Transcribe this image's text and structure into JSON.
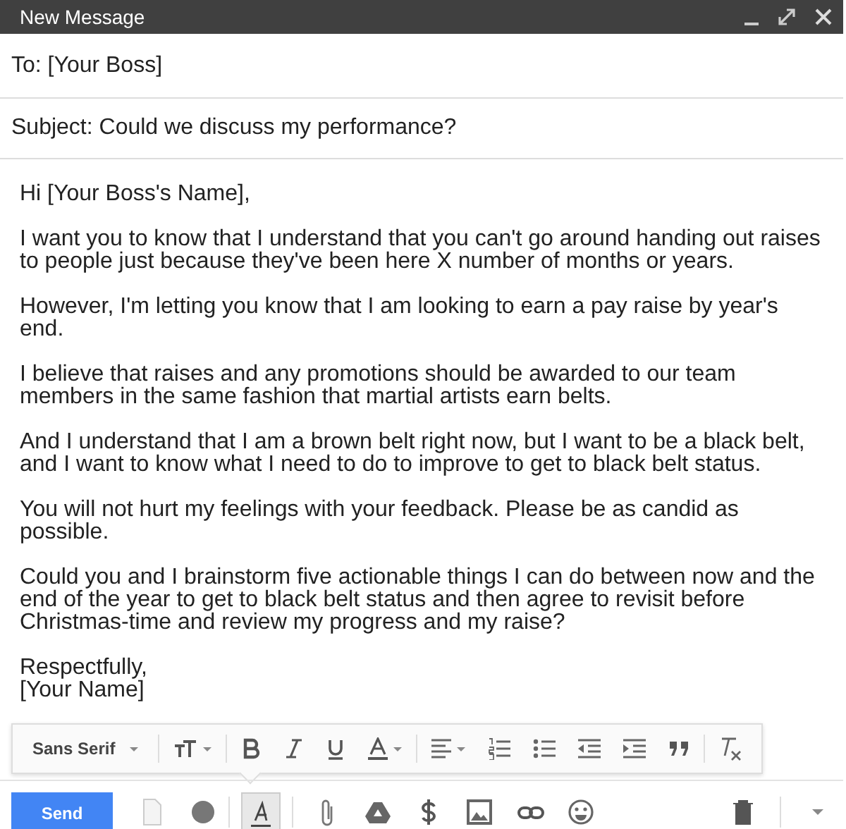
{
  "window": {
    "title": "New Message"
  },
  "to": "To: [Your Boss]",
  "subject": "Subject: Could we discuss my performance?",
  "body": [
    "Hi [Your Boss's Name],",
    "I want you to know that I understand that you can't go around handing out raises to people just because they've been here X number of months or years.",
    "However, I'm letting you know that I am looking to earn a pay raise by year's end.",
    "I believe that raises and any promotions should be awarded to our team members in the same fashion that martial artists earn belts.",
    "And I understand that I am a brown belt right now, but I want to be a black belt, and I want to know what I need to do to improve to get to black belt status.",
    "You will not hurt my feelings with your feedback. Please be as candid as possible.",
    "Could you and I brainstorm five actionable things I can do between now and the end of the year to get to black belt status and then agree to revisit before Christmas-time and review my progress and my raise?",
    "Respectfully,\n[Your Name]"
  ],
  "format_toolbar": {
    "font": "Sans Serif"
  },
  "toolbar": {
    "send": "Send",
    "formatting_selected": true
  }
}
